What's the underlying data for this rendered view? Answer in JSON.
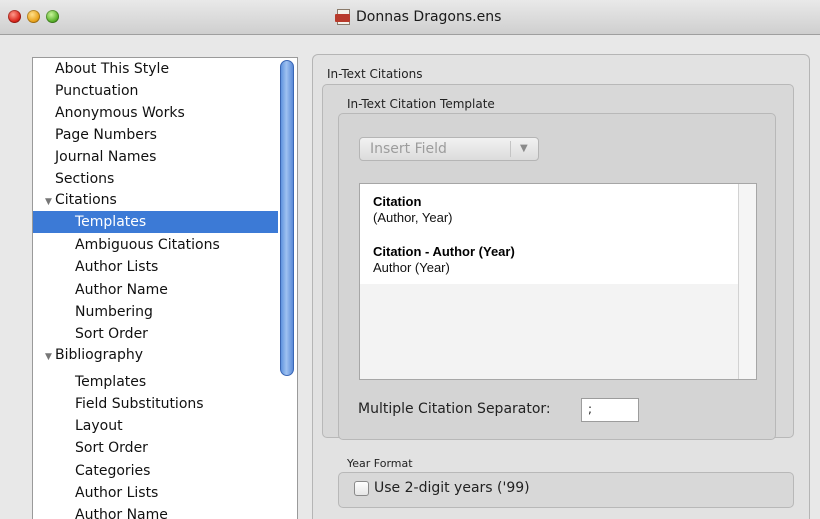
{
  "window": {
    "title": "Donnas Dragons.ens",
    "title_icon": "endnote-library-icon"
  },
  "sidebar": {
    "items": [
      {
        "label": "About This Style",
        "level": 0,
        "selected": false
      },
      {
        "label": "Punctuation",
        "level": 0,
        "selected": false
      },
      {
        "label": "Anonymous Works",
        "level": 0,
        "selected": false
      },
      {
        "label": "Page Numbers",
        "level": 0,
        "selected": false
      },
      {
        "label": "Journal Names",
        "level": 0,
        "selected": false
      },
      {
        "label": "Sections",
        "level": 0,
        "selected": false
      },
      {
        "label": "Citations",
        "level": 0,
        "disclosure": "expanded",
        "selected": false
      },
      {
        "label": "Templates",
        "level": 1,
        "selected": true
      },
      {
        "label": "Ambiguous Citations",
        "level": 1,
        "selected": false
      },
      {
        "label": "Author Lists",
        "level": 1,
        "selected": false
      },
      {
        "label": "Author Name",
        "level": 1,
        "selected": false
      },
      {
        "label": "Numbering",
        "level": 1,
        "selected": false
      },
      {
        "label": "Sort Order",
        "level": 1,
        "selected": false
      },
      {
        "label": "Bibliography",
        "level": 0,
        "disclosure": "expanded",
        "selected": false
      },
      {
        "label": "Templates",
        "level": 1,
        "selected": false
      },
      {
        "label": "Field Substitutions",
        "level": 1,
        "selected": false
      },
      {
        "label": "Layout",
        "level": 1,
        "selected": false
      },
      {
        "label": "Sort Order",
        "level": 1,
        "selected": false
      },
      {
        "label": "Categories",
        "level": 1,
        "selected": false
      },
      {
        "label": "Author Lists",
        "level": 1,
        "selected": false
      },
      {
        "label": "Author Name",
        "level": 1,
        "selected": false
      }
    ]
  },
  "panel": {
    "section_title": "In-Text Citations",
    "template_group_title": "In-Text Citation Template",
    "insert_field": {
      "label": "Insert Field",
      "enabled": false
    },
    "templates": [
      {
        "title": "Citation",
        "body": "(Author, Year)"
      },
      {
        "title": "Citation - Author (Year)",
        "body": "Author (Year)"
      }
    ],
    "separator": {
      "label": "Multiple Citation Separator:",
      "value": ";"
    },
    "year_format": {
      "title": "Year Format",
      "checkbox_label": "Use 2-digit years ('99)",
      "checked": false
    }
  },
  "colors": {
    "selection": "#3c7ad6",
    "scroll_thumb": "#6b9be0",
    "close": "#d9251b",
    "minimize": "#e9a21b",
    "zoom": "#58b02a"
  }
}
